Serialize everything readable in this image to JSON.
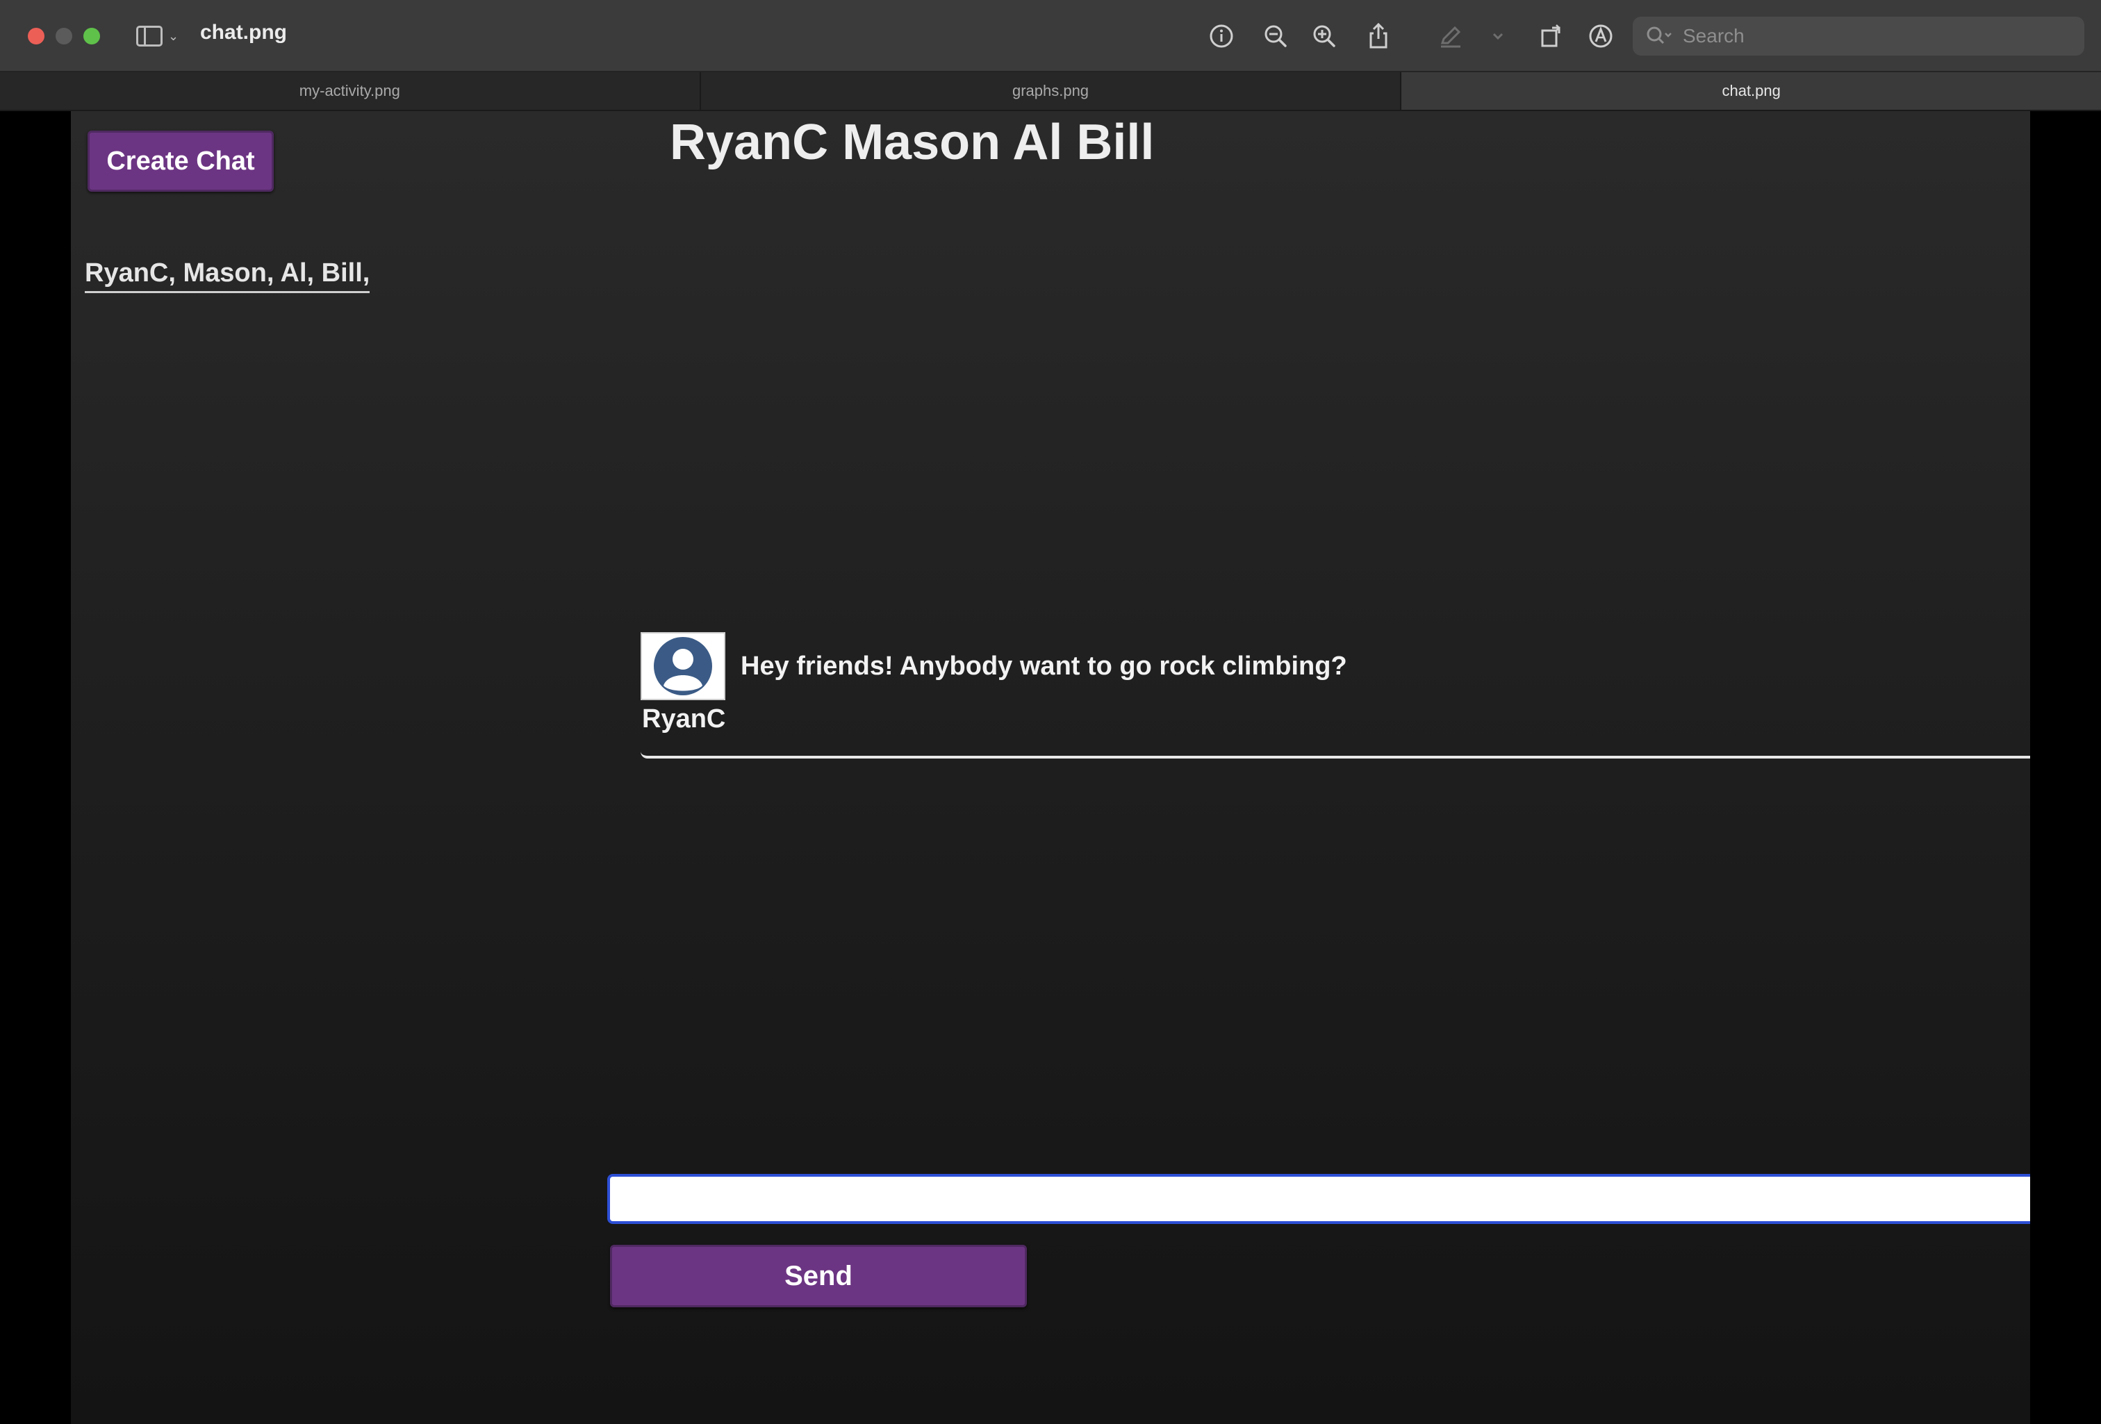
{
  "window": {
    "title": "chat.png",
    "search_placeholder": "Search",
    "toolbar_icons": [
      "info-icon",
      "zoom-out-icon",
      "zoom-in-icon",
      "share-icon",
      "markup-pen-icon",
      "chevron-down-icon",
      "rotate-icon",
      "annotate-icon"
    ]
  },
  "tabs": [
    {
      "label": "my-activity.png",
      "active": false
    },
    {
      "label": "graphs.png",
      "active": false
    },
    {
      "label": "chat.png",
      "active": true
    }
  ],
  "app": {
    "create_chat_label": "Create Chat",
    "chat_list_item": "RyanC, Mason, Al, Bill,",
    "chat_title": "RyanC Mason Al Bill",
    "messages": [
      {
        "text": "Hey friends! Anybody want to go rock climbing?",
        "author": "RyanC"
      }
    ],
    "input_value": "",
    "send_label": "Send",
    "colors": {
      "button_purple": "#6c3583",
      "input_focus_border": "#2d4fd6",
      "avatar_blue": "#3b5b86"
    }
  }
}
